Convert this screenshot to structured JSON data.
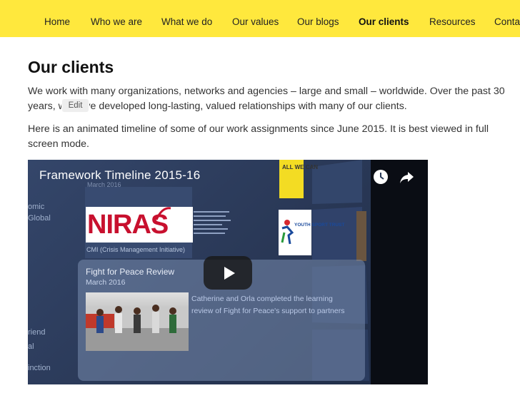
{
  "nav": {
    "items": [
      {
        "label": "Home"
      },
      {
        "label": "Who we are"
      },
      {
        "label": "What we do"
      },
      {
        "label": "Our values"
      },
      {
        "label": "Our blogs"
      },
      {
        "label": "Our clients"
      },
      {
        "label": "Resources"
      },
      {
        "label": "Contac"
      }
    ],
    "active_index": 5
  },
  "page": {
    "title": "Our clients",
    "intro": "We work with many organizations, networks and agencies – large and small – worldwide. Over the past 30 years, we have developed long-lasting, valued relationships with many of our clients.",
    "timeline_note": "Here is an animated timeline of some of our work assignments since June 2015. It is best viewed in full screen mode.",
    "edit_label": "Edit"
  },
  "video": {
    "title": "Framework Timeline 2015-16",
    "left_labels": [
      "omic",
      "Global",
      "riend",
      "al",
      "inction"
    ],
    "slide": {
      "date": "March 2016",
      "logo_text": "NIRAS",
      "caption": "CMI (Crisis Management Initiative)"
    },
    "allwecan_text": "ALL WE CAN",
    "youth_text": "YOUTH SPORT TRUST",
    "review": {
      "title": "Fight for Peace Review",
      "date": "March 2016",
      "description": "Catherine and Orla completed the learning review of Fight for Peace's support to partners"
    }
  },
  "colors": {
    "nav_bg": "#ffe83d",
    "brand_red": "#c8102e",
    "video_bg": "#2a3a57"
  }
}
